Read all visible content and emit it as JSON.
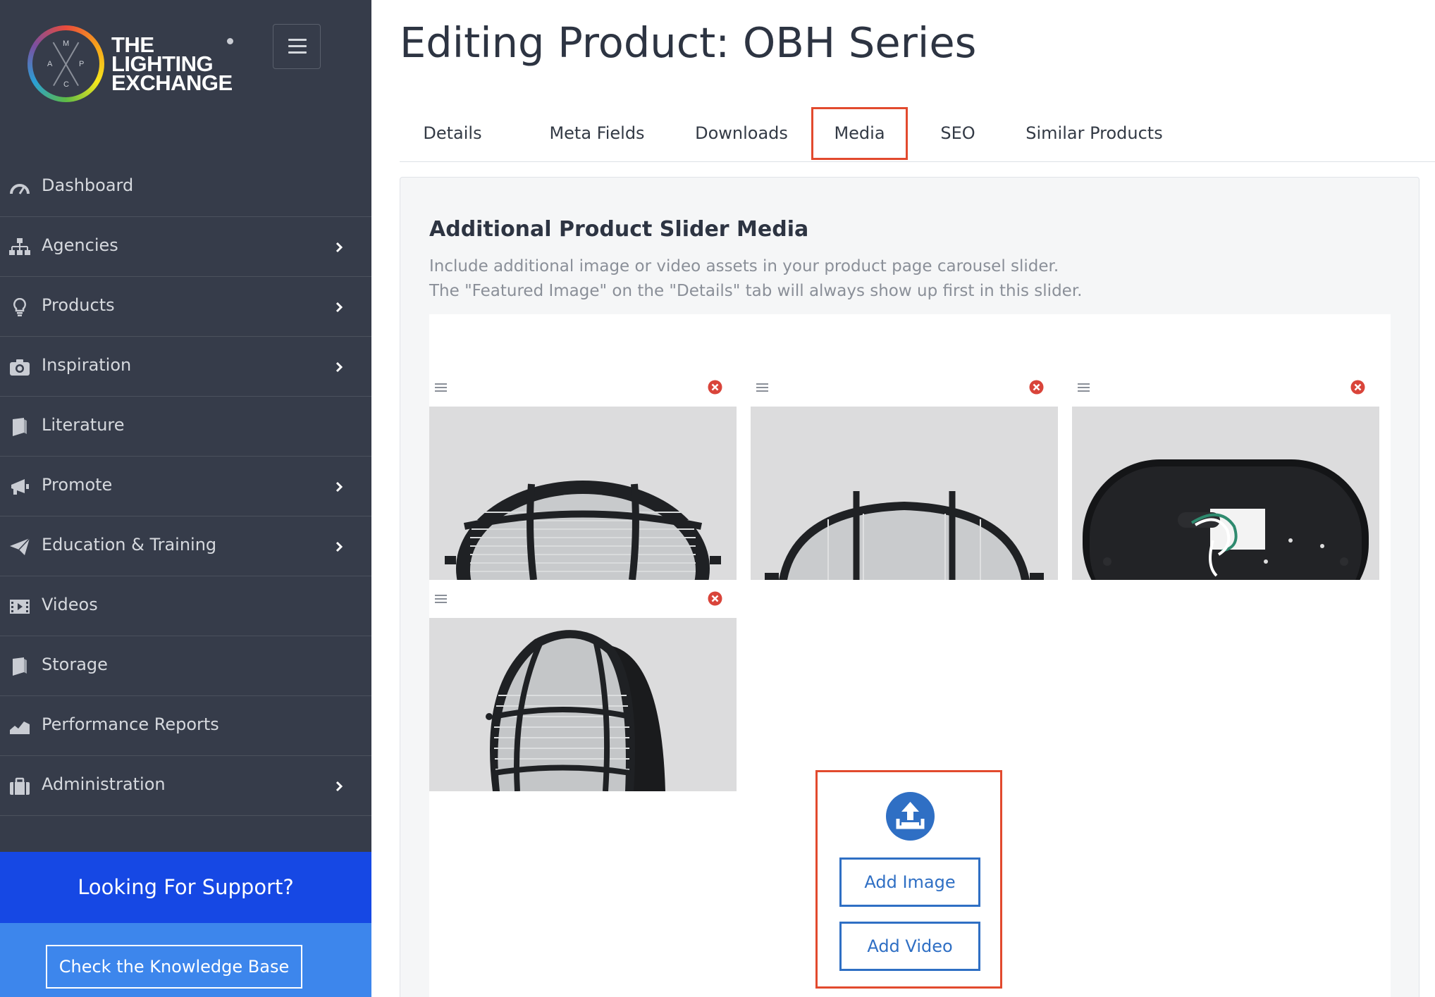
{
  "brand": {
    "logo_lines": [
      "THE",
      "LIGHTING",
      "EXCHANGE"
    ],
    "logo_letters": [
      "M",
      "A",
      "P",
      "C"
    ]
  },
  "sidebar": {
    "items": [
      {
        "label": "Dashboard",
        "icon": "gauge-icon",
        "has_submenu": false
      },
      {
        "label": "Agencies",
        "icon": "sitemap-icon",
        "has_submenu": true
      },
      {
        "label": "Products",
        "icon": "lightbulb-icon",
        "has_submenu": true
      },
      {
        "label": "Inspiration",
        "icon": "camera-icon",
        "has_submenu": true
      },
      {
        "label": "Literature",
        "icon": "book-icon",
        "has_submenu": false
      },
      {
        "label": "Promote",
        "icon": "megaphone-icon",
        "has_submenu": true
      },
      {
        "label": "Education & Training",
        "icon": "paper-plane-icon",
        "has_submenu": true
      },
      {
        "label": "Videos",
        "icon": "film-icon",
        "has_submenu": false
      },
      {
        "label": "Storage",
        "icon": "book-icon",
        "has_submenu": false
      },
      {
        "label": "Performance Reports",
        "icon": "area-chart-icon",
        "has_submenu": false
      },
      {
        "label": "Administration",
        "icon": "briefcase-icon",
        "has_submenu": true
      }
    ],
    "support": {
      "heading": "Looking For Support?",
      "button_label": "Check the Knowledge Base"
    }
  },
  "page": {
    "title": "Editing Product: OBH Series"
  },
  "tabs": [
    {
      "label": "Details",
      "active": false
    },
    {
      "label": "Meta Fields",
      "active": false
    },
    {
      "label": "Downloads",
      "active": false
    },
    {
      "label": "Media",
      "active": true
    },
    {
      "label": "SEO",
      "active": false
    },
    {
      "label": "Similar Products",
      "active": false
    }
  ],
  "media_section": {
    "title": "Additional Product Slider Media",
    "description_lines": [
      "Include additional image or video assets in your product page carousel slider.",
      "The \"Featured Image\" on the \"Details\" tab will always show up first in this slider."
    ],
    "items": [
      {
        "view": "front-caged-light"
      },
      {
        "view": "side-caged-light"
      },
      {
        "view": "back-wiring"
      },
      {
        "view": "angled-caged-light"
      }
    ],
    "upload": {
      "add_image_label": "Add Image",
      "add_video_label": "Add Video"
    }
  },
  "colors": {
    "sidebar_bg": "#363c4a",
    "support_head": "#1648e4",
    "support_body": "#3d86ec",
    "accent_blue": "#2f6fc4",
    "highlight_red": "#e24a2e",
    "remove_red": "#d9443a"
  }
}
